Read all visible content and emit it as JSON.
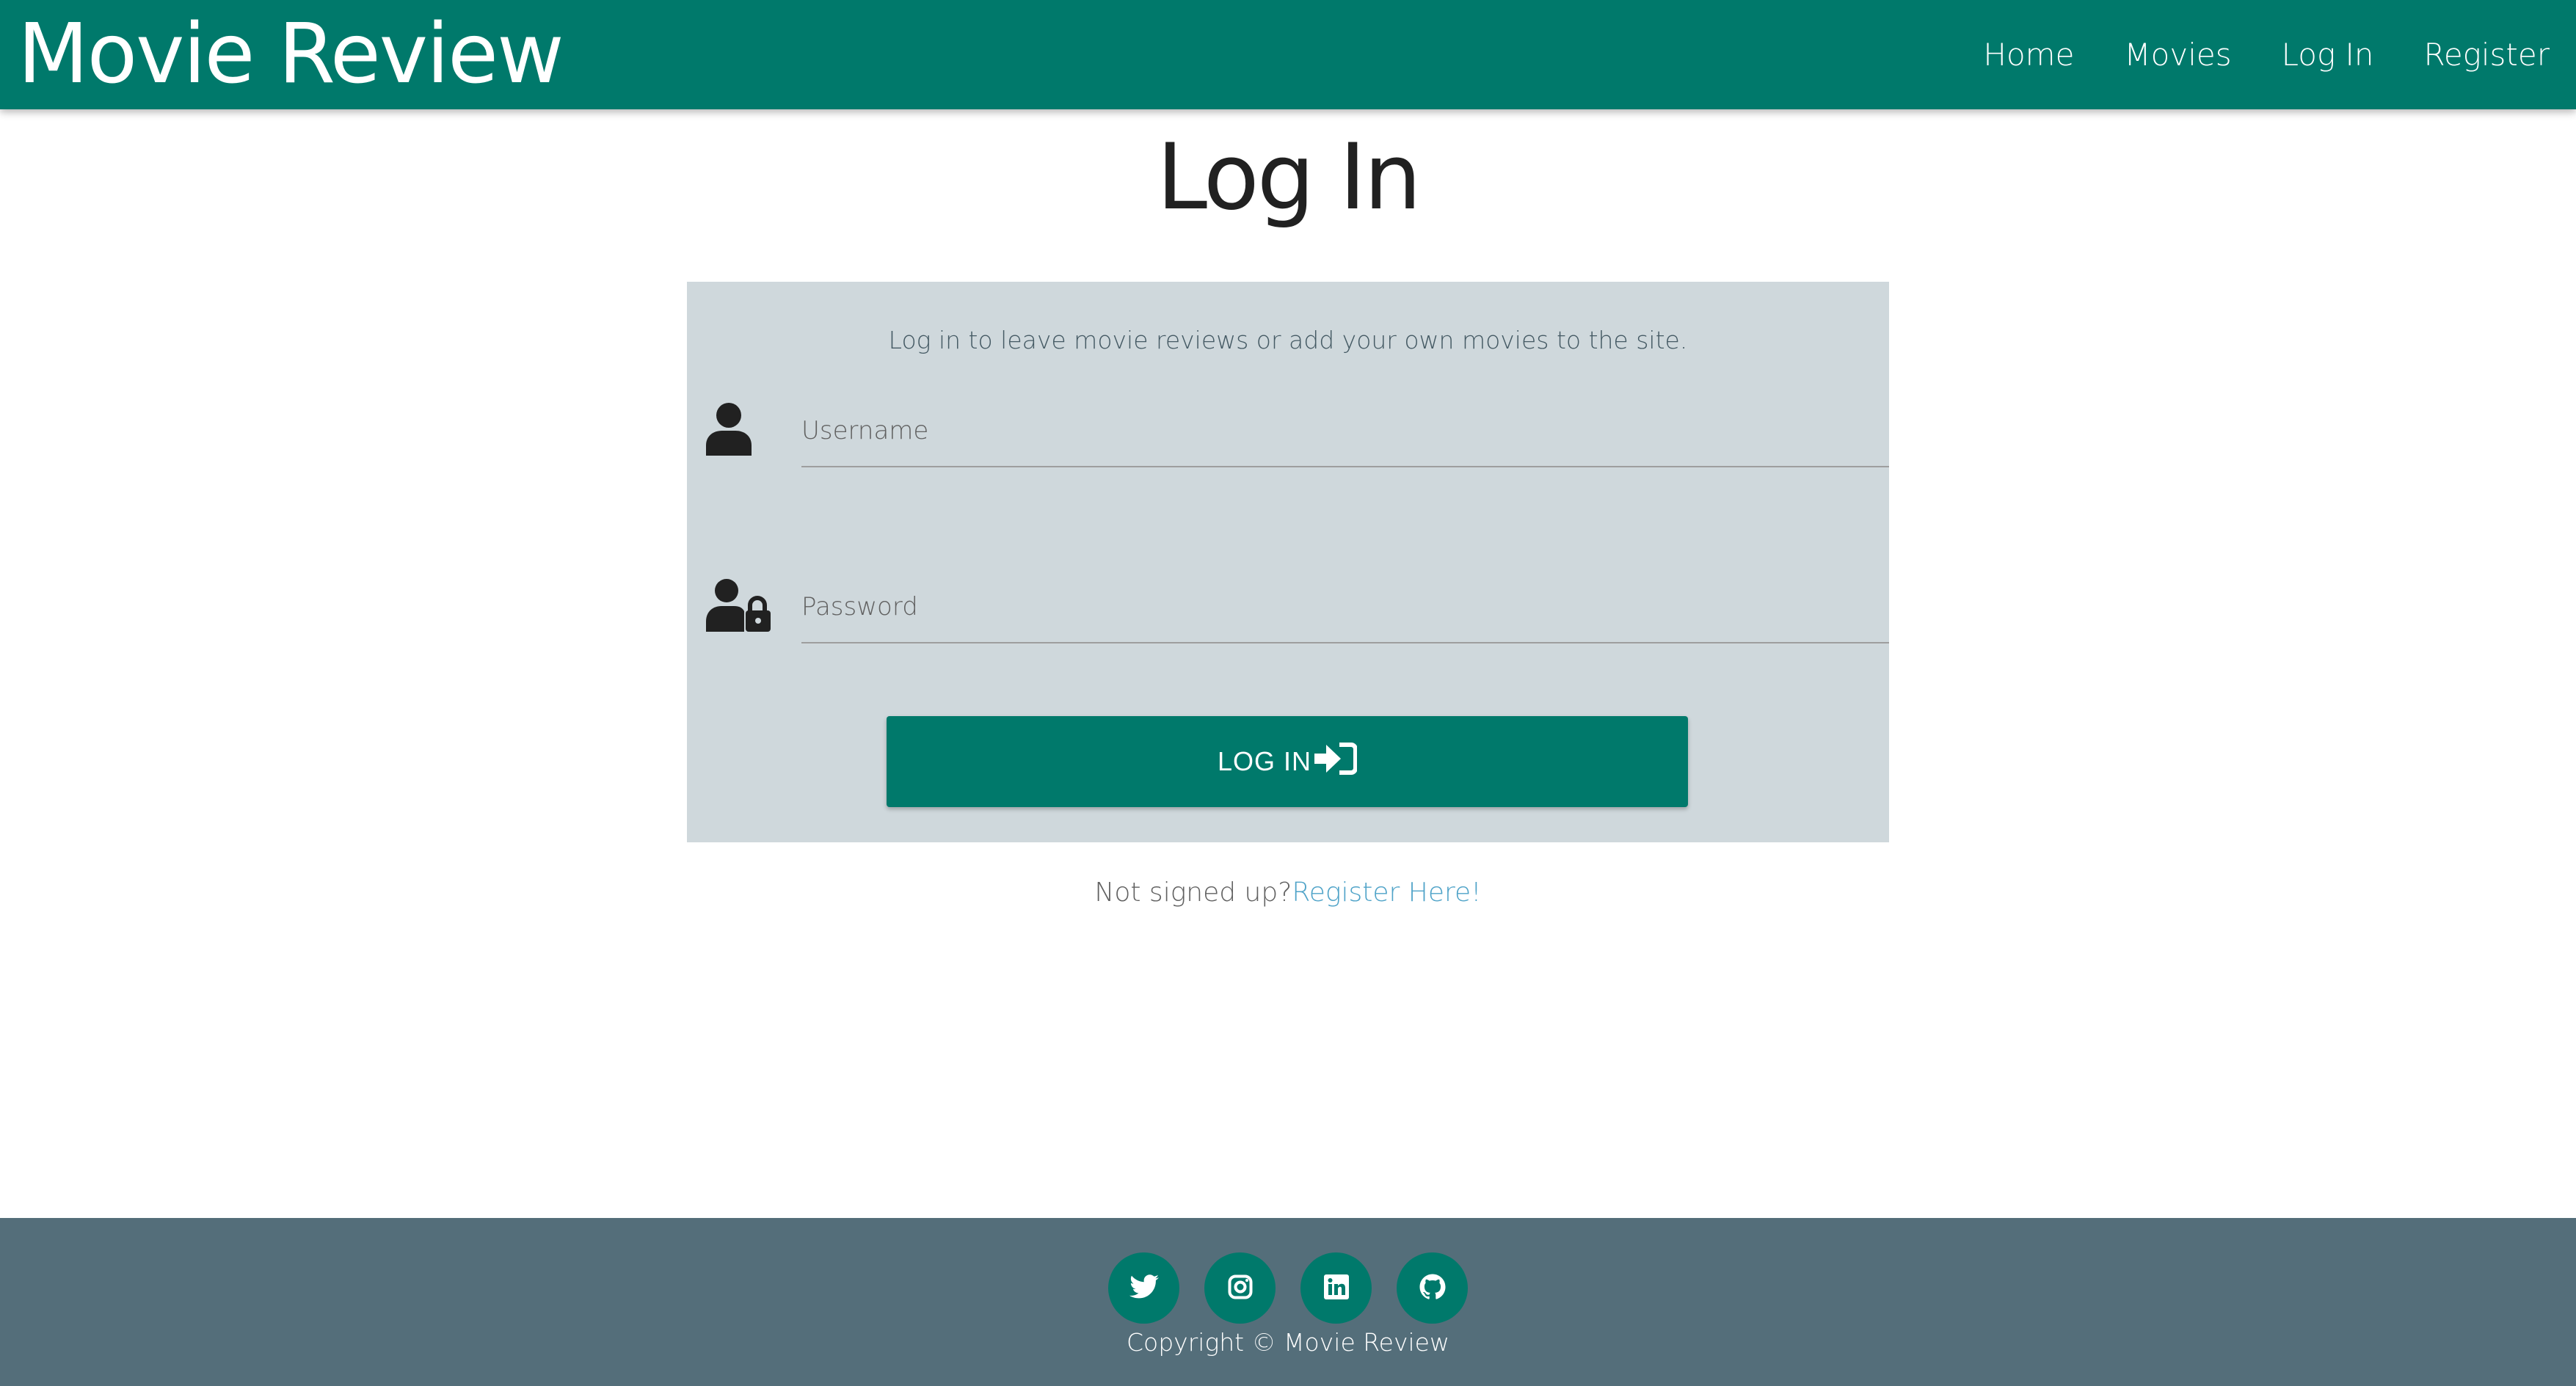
{
  "colors": {
    "primary": "#00796b",
    "card_background": "#cfd8dc",
    "footer_background": "#546e7a",
    "link": "#4fa3c8"
  },
  "navbar": {
    "brand": "Movie Review",
    "links": [
      {
        "label": "Home"
      },
      {
        "label": "Movies"
      },
      {
        "label": "Log In"
      },
      {
        "label": "Register"
      }
    ]
  },
  "main": {
    "title": "Log In",
    "intro": "Log in to leave movie reviews or add your own movies to the site.",
    "username": {
      "placeholder": "Username",
      "value": "",
      "icon": "user-icon"
    },
    "password": {
      "placeholder": "Password",
      "value": "",
      "icon": "user-lock-icon"
    },
    "login_button": {
      "label": "LOG IN",
      "icon": "sign-in-icon"
    },
    "signup_prompt": "Not signed up?",
    "register_link": "Register Here!"
  },
  "footer": {
    "socials": [
      {
        "icon": "twitter-icon"
      },
      {
        "icon": "instagram-icon"
      },
      {
        "icon": "linkedin-icon"
      },
      {
        "icon": "github-icon"
      }
    ],
    "copyright": "Copyright © Movie Review"
  }
}
